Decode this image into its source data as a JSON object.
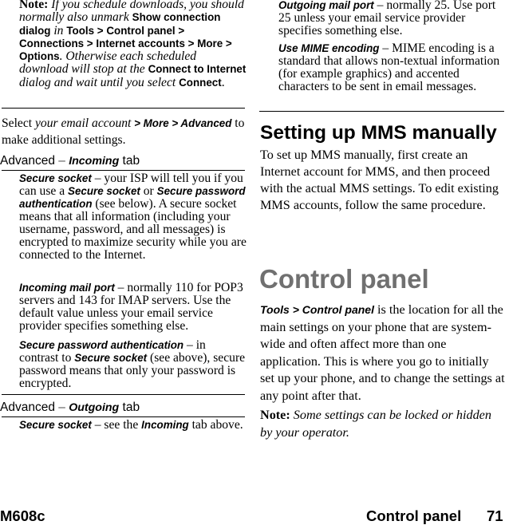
{
  "left": {
    "note": {
      "label": "Note:",
      "t1": " If you schedule downloads, you should normally also unmark ",
      "b1": "Show connection dialog",
      "t2": " in ",
      "b2": "Tools > Control panel > Connections > Internet accounts > More > Options",
      "t3": ". Otherwise each scheduled download will stop at the ",
      "b3": "Connect to Internet",
      "t4": " dialog and wait until you select ",
      "b4": "Connect",
      "t5": "."
    },
    "select_para": {
      "t1": "Select ",
      "i1": "your email account",
      "b1": " > More > Advanced",
      "t2": " to make additional settings."
    },
    "incoming_heading": {
      "prefix": "Advanced ",
      "dash": "–",
      "tab": "Incoming",
      "suffix": " tab"
    },
    "incoming_items": [
      {
        "term": "Secure socket",
        "text1": " – your ISP will tell you if you can use a ",
        "b1": "Secure socket",
        "text2": " or ",
        "b2": "Secure password authentication",
        "text3": " (see below). A secure socket means that all information (including your username, password, and all messages) is encrypted to maximize security while you are connected to the Internet."
      },
      {
        "term": "Incoming mail port",
        "text1": " – normally 110 for POP3 servers and 143 for IMAP servers. Use the default value unless your email service provider specifies something else."
      },
      {
        "term": "Secure password authentication",
        "text1": " – in contrast to ",
        "b1": "Secure socket",
        "text2": " (see above), secure password means that only your password is encrypted."
      }
    ],
    "outgoing_heading": {
      "prefix": "Advanced ",
      "dash": "–",
      "tab": "Outgoing",
      "suffix": " tab"
    },
    "outgoing_items": [
      {
        "term": "Secure socket",
        "text1": " – see the ",
        "b1": "Incoming",
        "text2": " tab above."
      }
    ]
  },
  "right": {
    "outgoing_items": [
      {
        "term": "Outgoing mail port",
        "text1": " – normally 25. Use port 25 unless your email service provider specifies something else."
      },
      {
        "term": "Use MIME encoding",
        "text1": " – MIME encoding is a standard that allows non-textual information (for example graphics) and accented characters to be sent in email messages."
      }
    ],
    "mms_heading": "Setting up MMS manually",
    "mms_body": "To set up MMS manually, first create an Internet account for MMS, and then proceed with the actual MMS settings. To edit existing MMS accounts, follow the same procedure.",
    "cp_heading": "Control panel",
    "cp_body": {
      "b1": "Tools > Control panel",
      "t1": " is the location for all the main settings on your phone that are system-wide and often affect more than one application. This is where you go to initially set up your phone, and to change the settings at any point after that."
    },
    "note": {
      "label": "Note:",
      "text": " Some settings can be locked or hidden by your operator."
    }
  },
  "footer": {
    "model": "M608c",
    "section": "Control panel",
    "page": "71"
  },
  "colors": {
    "chapter_heading": "#707070",
    "text": "#000000"
  }
}
